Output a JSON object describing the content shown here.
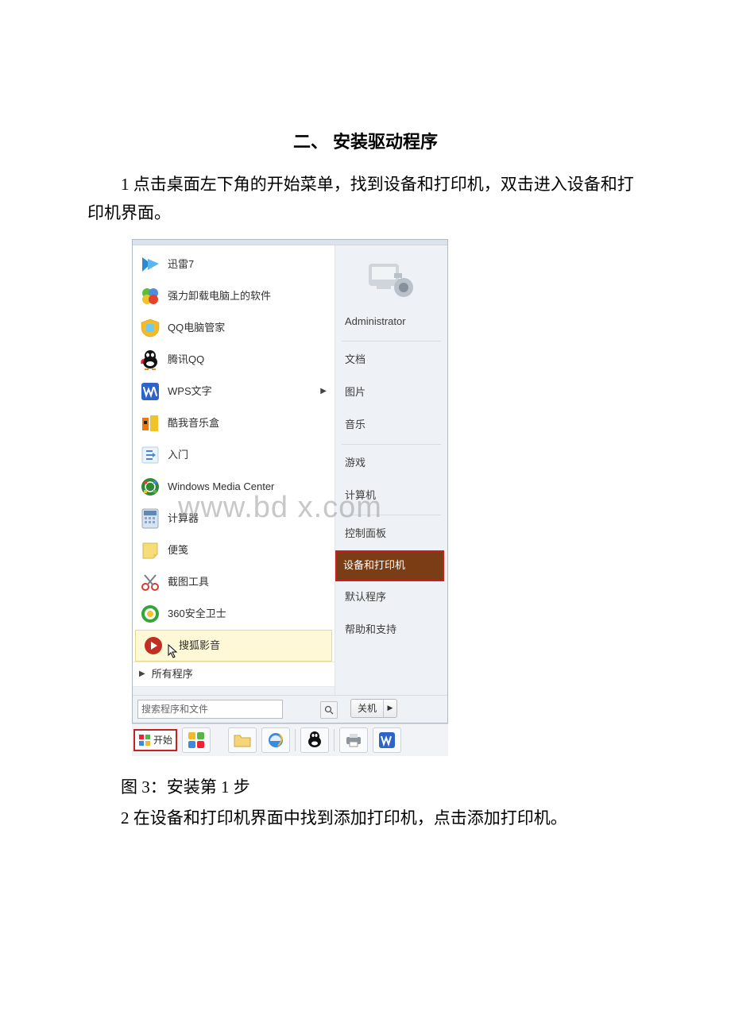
{
  "heading": "二、 安装驱动程序",
  "paragraph1": "1 点击桌面左下角的开始菜单，找到设备和打印机，双击进入设备和打印机界面。",
  "caption": "图 3：安装第 1 步",
  "paragraph2": "2 在设备和打印机界面中找到添加打印机，点击添加打印机。",
  "watermark": "www.bd  x.com",
  "startmenu": {
    "left_items": [
      {
        "label": "迅雷7",
        "icon": "xunlei",
        "arrow": false
      },
      {
        "label": "强力卸载电脑上的软件",
        "icon": "clover",
        "arrow": false
      },
      {
        "label": "QQ电脑管家",
        "icon": "qqmgr",
        "arrow": false
      },
      {
        "label": "腾讯QQ",
        "icon": "qq",
        "arrow": false
      },
      {
        "label": "WPS文字",
        "icon": "wps",
        "arrow": true
      },
      {
        "label": "酷我音乐盒",
        "icon": "kuwo",
        "arrow": false
      },
      {
        "label": "入门",
        "icon": "arrow-r",
        "arrow": false
      },
      {
        "label": "Windows Media Center",
        "icon": "wmc",
        "arrow": false
      },
      {
        "label": "计算器",
        "icon": "calc",
        "arrow": false
      },
      {
        "label": "便笺",
        "icon": "note",
        "arrow": false
      },
      {
        "label": "截图工具",
        "icon": "snip",
        "arrow": false
      },
      {
        "label": "360安全卫士",
        "icon": "360",
        "arrow": false
      },
      {
        "label": "搜狐影音",
        "icon": "sohu",
        "arrow": false,
        "highlight": true,
        "cursor": true
      }
    ],
    "all_programs": "所有程序",
    "search_placeholder": "搜索程序和文件",
    "right_user": "Administrator",
    "right_items": [
      {
        "label": "文档"
      },
      {
        "label": "图片"
      },
      {
        "label": "音乐"
      },
      {
        "sep": true
      },
      {
        "label": "游戏"
      },
      {
        "label": "计算机"
      },
      {
        "sep": true
      },
      {
        "label": "控制面板"
      },
      {
        "label": "设备和打印机",
        "highlight": true
      },
      {
        "label": "默认程序"
      },
      {
        "label": "帮助和支持"
      }
    ],
    "shutdown": "关机"
  },
  "taskbar": {
    "start": "开始"
  }
}
